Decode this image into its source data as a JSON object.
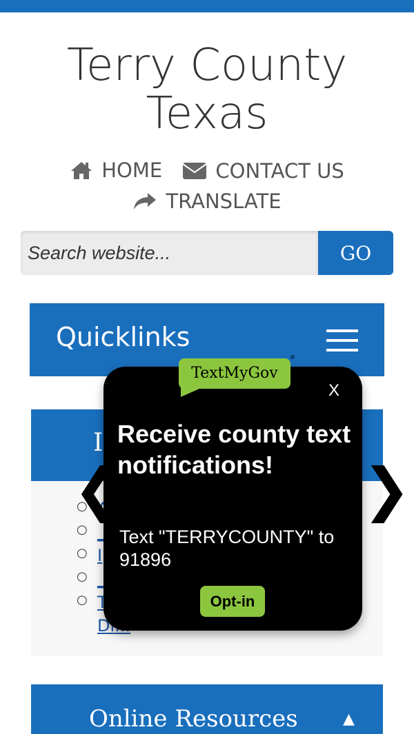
{
  "site": {
    "title_line1": "Terry County",
    "title_line2": "Texas"
  },
  "nav": {
    "home": {
      "label": "HOME",
      "icon": "home-icon"
    },
    "contact": {
      "label": "CONTACT US",
      "icon": "envelope-icon"
    },
    "translate": {
      "label": "TRANSLATE",
      "icon": "share-arrow-icon"
    }
  },
  "search": {
    "placeholder": "Search website...",
    "value": "",
    "button": "GO"
  },
  "quicklinks": {
    "title": "Quicklinks",
    "menu_icon": "hamburger-icon"
  },
  "panel": {
    "title_visible": "I",
    "items": [
      {
        "bullet": "○",
        "text": "A"
      },
      {
        "bullet": "○",
        "text": "_"
      },
      {
        "bullet": "○",
        "text": "I"
      },
      {
        "bullet": "○",
        "text": "_"
      },
      {
        "bullet": "○",
        "text": "T"
      }
    ],
    "trailing_text": "Di..."
  },
  "online_resources": {
    "label": "Online Resources",
    "arrow": "▲"
  },
  "popup": {
    "brand": "TextMyGov",
    "close": "X",
    "title": "Receive county text notifications!",
    "body": "Text \"TERRYCOUNTY\" to 91896",
    "optin": "Opt-in",
    "prev": "❮",
    "next": "❯"
  },
  "colors": {
    "primary": "#1a6fbd",
    "popup_bg": "#000000",
    "accent_green": "#8cc63f"
  }
}
